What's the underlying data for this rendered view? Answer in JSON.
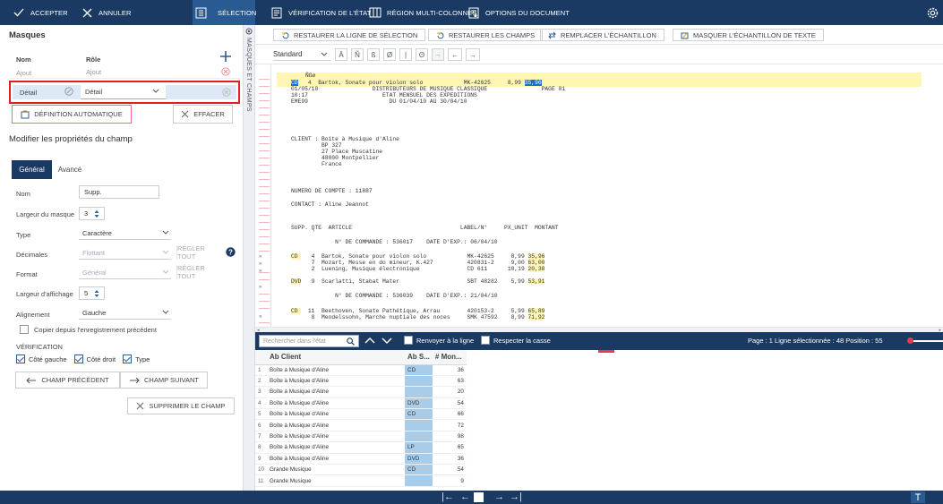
{
  "topbar": {
    "accept": "ACCEPTER",
    "cancel": "ANNULER",
    "selection": "SÉLECTION",
    "verify": "VÉRIFICATION DE L'ÉTAT",
    "multicol": "RÉGION MULTI-COLONNES",
    "docopts": "OPTIONS DU DOCUMENT"
  },
  "vertical_tab": "MASQUES ET CHAMPS",
  "masks": {
    "title": "Masques",
    "col_name": "Nom",
    "col_role": "Rôle",
    "rows": [
      {
        "name": "Ajout",
        "role": "Ajout"
      },
      {
        "name": "Détail",
        "role": "Détail"
      }
    ],
    "auto_def": "DÉFINITION AUTOMATIQUE",
    "clear": "EFFACER"
  },
  "props": {
    "title": "Modifier les propriétés du champ",
    "tab_general": "Général",
    "tab_advanced": "Avancé",
    "name_label": "Nom",
    "name_value": "Supp.",
    "width_label": "Largeur du masque",
    "width_value": "3",
    "type_label": "Type",
    "type_value": "Caractère",
    "decimals_label": "Décimales",
    "decimals_value": "Flottant",
    "format_label": "Format",
    "format_value": "Général",
    "adjust_all": "RÉGLER TOUT",
    "display_width_label": "Largeur d'affichage",
    "display_width_value": "5",
    "align_label": "Alignement",
    "align_value": "Gauche",
    "copy_prev": "Copier depuis l'enregistrement précédent",
    "verification_title": "VÉRIFICATION",
    "left_side": "Côté gauche",
    "right_side": "Côté droit",
    "type_chk": "Type",
    "prev_field": "CHAMP PRÉCÉDENT",
    "next_field": "CHAMP SUIVANT",
    "delete_field": "SUPPRIMER LE CHAMP"
  },
  "toolbar": {
    "restore_line": "RESTAURER LA LIGNE DE SÉLECTION",
    "restore_fields": "RESTAURER LES CHAMPS",
    "replace_sample": "REMPLACER L'ÉCHANTILLON",
    "hide_sample": "MASQUER L'ÉCHANTILLON DE TEXTE",
    "template": "Standard",
    "symbols": [
      "Ā",
      "Ñ",
      "ß",
      "Ø",
      "|",
      "Θ",
      "¬",
      "←",
      "→"
    ]
  },
  "report": {
    "sample": "Ñßø",
    "lines": [
      "   4  Bartok, Sonate pour violon solo            MK-42625     8,99",
      "01/05/10                DISTRIBUTEURS DE MUSIQUE CLASSIQUE                PAGE 01",
      "10:17                      ETAT MENSUEL DES EXPEDITIONS",
      "EME99                        DU 01/04/10 AU 30/04/10",
      "CLIENT : Boite à Musique d'Aline",
      "         BP 327",
      "         27 Place Muscatine",
      "         48000 Montpellier",
      "         France",
      "NUMERO DE COMPTE : 11887",
      "CONTACT : Aline Jeannot",
      "SUPP. QTE  ARTICLE                                LABEL/N°     PX_UNIT  MONTANT",
      "             N° DE COMMANDE : 536017    DATE D'EXP.: 06/04/10",
      "   4  Bartok, Sonate pour violon solo            MK-42625     8,99",
      "   7  Mozart, Messe en do mineur, K.427          420831-2     9,00",
      "   2  Luening, Musique électronique              CD 611      10,19",
      "   9  Scarlatti, Stabat Mater                    SBT 48282    5,99",
      "             N° DE COMMANDE : 536039    DATE D'EXP.: 21/04/10",
      "  11  Beethoven, Sonate Pathétique, Arrau        420153-2     5,99",
      "   8  Mendelssohn, Marche nuptiale des noces     SMK 47592    8,99"
    ],
    "supp": [
      "CD",
      "CD",
      "DVD",
      "CD"
    ],
    "amount_first": "35,96",
    "amounts": [
      "35,96",
      "63,00",
      "20,38",
      "53,91",
      "65,89",
      "71,92"
    ]
  },
  "search": {
    "placeholder": "Rechercher dans l'état",
    "wrap": "Renvoyer à la ligne",
    "case": "Respecter la casse",
    "status": "Page : 1   Ligne sélectionnée : 48   Position : 55"
  },
  "table": {
    "headers": [
      "Ab Client",
      "Ab S...",
      "# Mon..."
    ],
    "rows": [
      {
        "n": "1",
        "client": "Boîte à Musique d'Aline",
        "supp": "CD",
        "amount": "36"
      },
      {
        "n": "2",
        "client": "Boîte à Musique d'Aline",
        "supp": "",
        "amount": "63"
      },
      {
        "n": "3",
        "client": "Boîte à Musique d'Aline",
        "supp": "",
        "amount": "20"
      },
      {
        "n": "4",
        "client": "Boîte à Musique d'Aline",
        "supp": "DVD",
        "amount": "54"
      },
      {
        "n": "5",
        "client": "Boîte à Musique d'Aline",
        "supp": "CD",
        "amount": "66"
      },
      {
        "n": "6",
        "client": "Boîte à Musique d'Aline",
        "supp": "",
        "amount": "72"
      },
      {
        "n": "7",
        "client": "Boîte à Musique d'Aline",
        "supp": "",
        "amount": "98"
      },
      {
        "n": "8",
        "client": "Boîte à Musique d'Aline",
        "supp": "LP",
        "amount": "65"
      },
      {
        "n": "9",
        "client": "Boîte à Musique d'Aline",
        "supp": "DVD",
        "amount": "36"
      },
      {
        "n": "10",
        "client": "Grande Musique",
        "supp": "CD",
        "amount": "54"
      },
      {
        "n": "11",
        "client": "Grande Musique",
        "supp": "",
        "amount": "9"
      }
    ]
  },
  "colors": {
    "nav": "#1b3a63",
    "accent": "#2c5d94",
    "highlight_blue": "#a9cce8",
    "highlight_yellow": "#fff6b3",
    "red_outline": "#e02020"
  }
}
